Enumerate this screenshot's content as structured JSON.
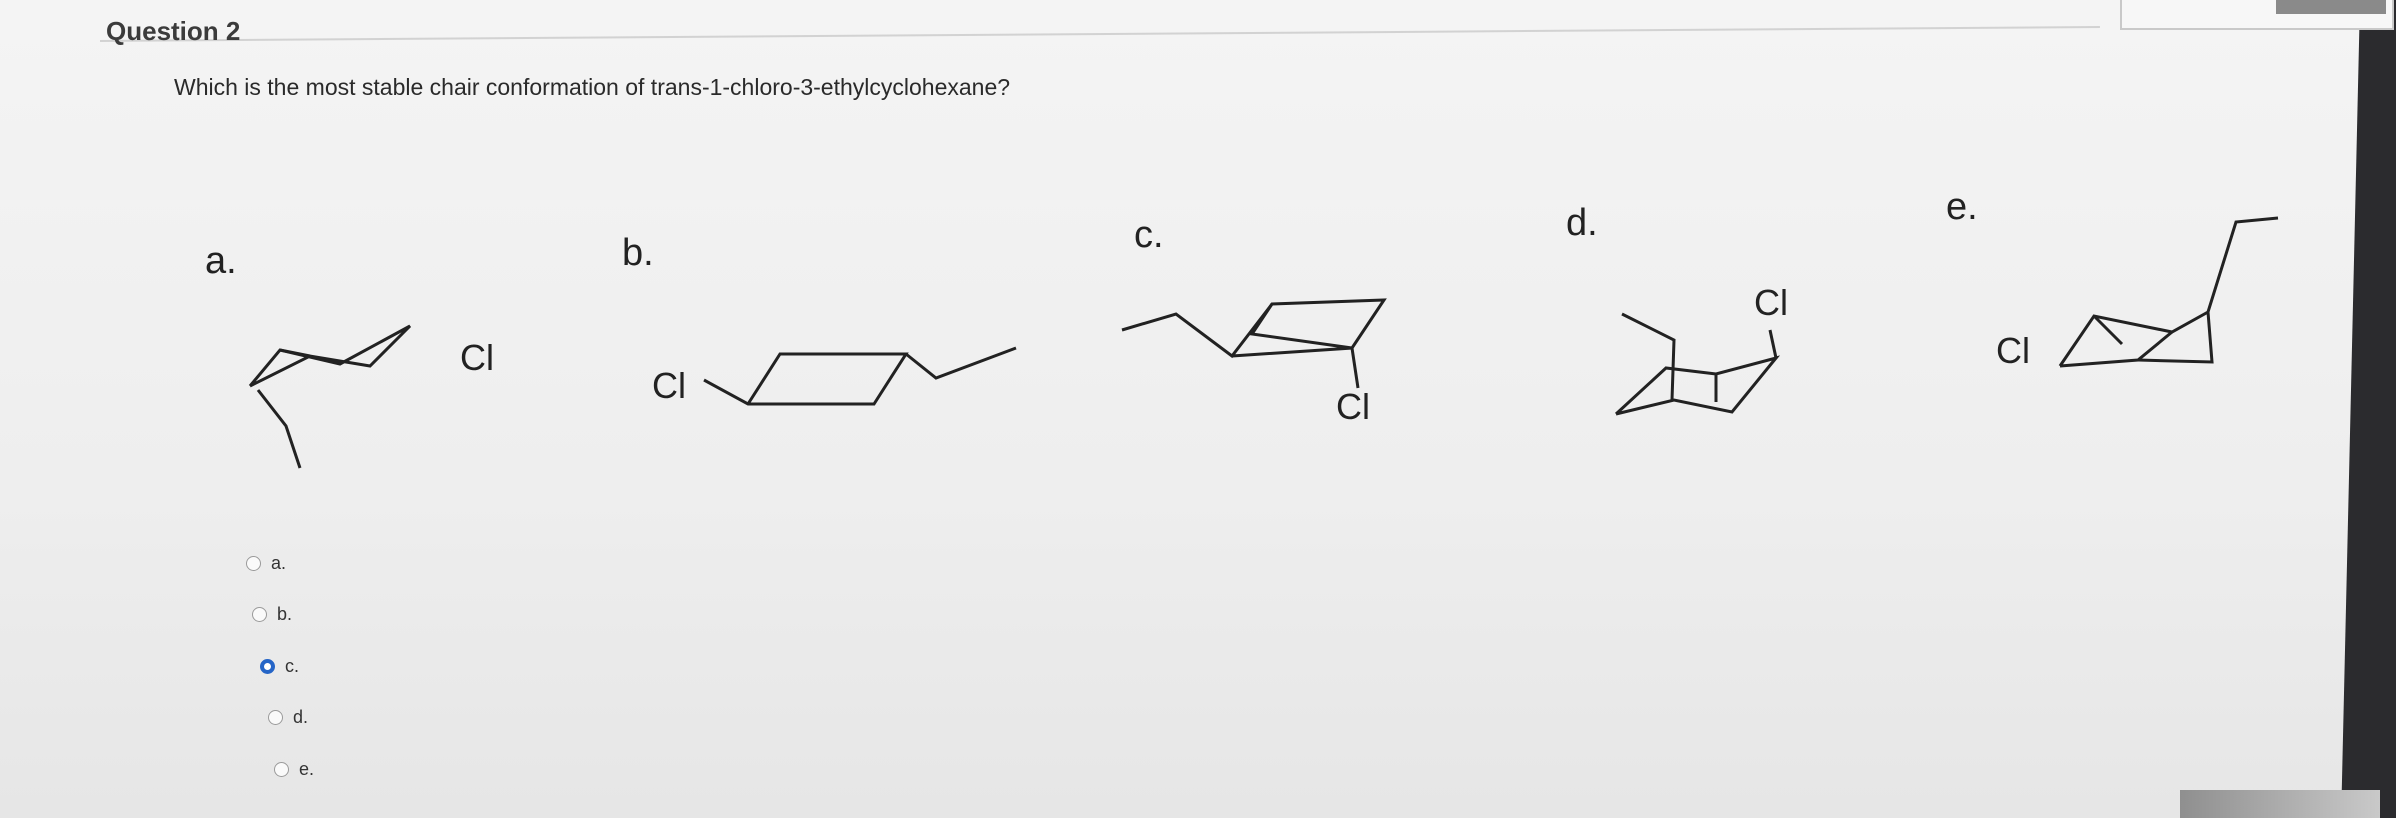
{
  "question": {
    "title": "Question 2",
    "text": "Which is the most stable chair conformation of trans-1-chloro-3-ethylcyclohexane?"
  },
  "structures": [
    {
      "letter": "a.",
      "atom": "Cl"
    },
    {
      "letter": "b.",
      "atom": "Cl"
    },
    {
      "letter": "c.",
      "atom": "Cl"
    },
    {
      "letter": "d.",
      "atom": "Cl"
    },
    {
      "letter": "e.",
      "atom": "Cl"
    }
  ],
  "choices": [
    {
      "label": "a.",
      "selected": false
    },
    {
      "label": "b.",
      "selected": false
    },
    {
      "label": "c.",
      "selected": true
    },
    {
      "label": "d.",
      "selected": false
    },
    {
      "label": "e.",
      "selected": false
    }
  ],
  "colors": {
    "selected_radio": "#2565c7",
    "text": "#2a2a2a"
  }
}
